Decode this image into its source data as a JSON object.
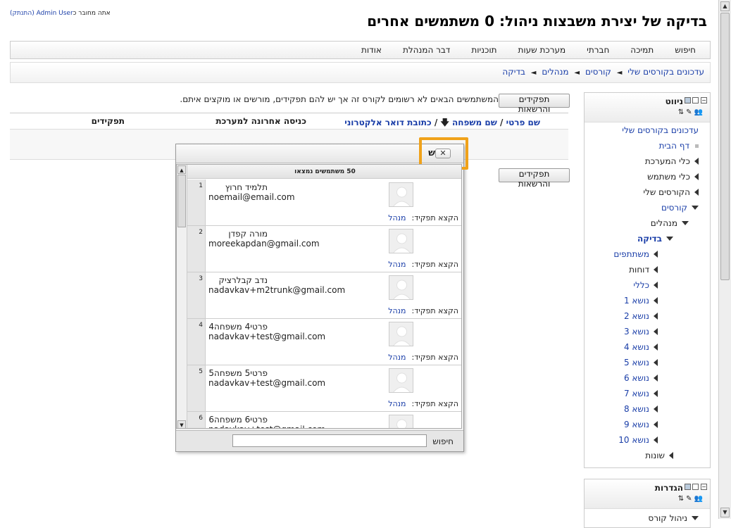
{
  "login": {
    "text": "אתה מחובר כ",
    "user": "Admin User",
    "logout": "(התנתק)"
  },
  "page_title": "בדיקה של יצירת משבצות ניהול: 0 משתמשים אחרים",
  "main_menu": [
    "חיפוש",
    "תמיכה",
    "חברתי",
    "מערכת שעות",
    "תוכניות",
    "דבר המנהלת",
    "אודות"
  ],
  "breadcrumb": [
    "עדכונים בקורסים שלי",
    "קורסים",
    "מנהלים",
    "בדיקה"
  ],
  "breadcrumb_sep": "◄",
  "content": {
    "roles_button": "תפקידים והרשאות",
    "intro": "המשתמשים הבאים לא רשומים לקורס זה אך יש להם תפקידים, מורשים או מוקצים איתם.",
    "col_first": "שם פרטי",
    "col_slash": "/",
    "col_last": "שם משפחה",
    "col_sort": "🡇",
    "col_email": "כתובת דואר אלקטרוני",
    "col_lastaccess": "כניסה אחרונה למערכת",
    "col_roles": "תפקידים"
  },
  "nav_block": {
    "title": "ניווט",
    "items": [
      {
        "label": "עדכונים בקורסים שלי",
        "type": "link",
        "indent": 0
      },
      {
        "label": "דף הבית",
        "type": "link-bullet",
        "indent": 0
      },
      {
        "label": "כלי המערכת",
        "type": "collapsed",
        "indent": 0
      },
      {
        "label": "כלי משתמש",
        "type": "collapsed",
        "indent": 0
      },
      {
        "label": "הקורסים שלי",
        "type": "collapsed",
        "indent": 0
      },
      {
        "label": "קורסים",
        "type": "expanded-link",
        "indent": 0
      },
      {
        "label": "מנהלים",
        "type": "expanded",
        "indent": 1
      },
      {
        "label": "בדיקה",
        "type": "expanded-active",
        "indent": 2
      },
      {
        "label": "משתתפים",
        "type": "collapsed-link",
        "indent": 3
      },
      {
        "label": "דוחות",
        "type": "collapsed",
        "indent": 3
      },
      {
        "label": "כללי",
        "type": "collapsed-link",
        "indent": 3
      },
      {
        "label": "נושא 1",
        "type": "collapsed-link",
        "indent": 3
      },
      {
        "label": "נושא 2",
        "type": "collapsed-link",
        "indent": 3
      },
      {
        "label": "נושא 3",
        "type": "collapsed-link",
        "indent": 3
      },
      {
        "label": "נושא 4",
        "type": "collapsed-link",
        "indent": 3
      },
      {
        "label": "נושא 5",
        "type": "collapsed-link",
        "indent": 3
      },
      {
        "label": "נושא 6",
        "type": "collapsed-link",
        "indent": 3
      },
      {
        "label": "נושא 7",
        "type": "collapsed-link",
        "indent": 3
      },
      {
        "label": "נושא 8",
        "type": "collapsed-link",
        "indent": 3
      },
      {
        "label": "נושא 9",
        "type": "collapsed-link",
        "indent": 3
      },
      {
        "label": "נושא 10",
        "type": "collapsed-link",
        "indent": 3
      },
      {
        "label": "שונות",
        "type": "collapsed",
        "indent": 2
      }
    ]
  },
  "settings_block": {
    "title": "הגדרות",
    "partial": "ניהול קורס"
  },
  "dialog": {
    "title": "ש",
    "close": "✕",
    "found": "50 משתמשים נמצאו",
    "assign_label": "הקצא תפקיד:",
    "role": "מנהל",
    "search_label": "חיפוש",
    "search_value": "",
    "users": [
      {
        "num": "1",
        "name": "תלמיד חרוץ",
        "email": "noemail@email.com"
      },
      {
        "num": "2",
        "name": "מורה קפדן",
        "email": "moreekapdan@gmail.com"
      },
      {
        "num": "3",
        "name": "נדב קבלרציק",
        "email": "nadavkav+m2trunk@gmail.com"
      },
      {
        "num": "4",
        "name": "פרטי4 משפחה4",
        "email": "nadavkav+test@gmail.com"
      },
      {
        "num": "5",
        "name": "פרטי5 משפחה5",
        "email": "nadavkav+test@gmail.com"
      },
      {
        "num": "6",
        "name": "פרטי6 משפחה6",
        "email": "nadavkav+test@gmail.com"
      }
    ]
  }
}
